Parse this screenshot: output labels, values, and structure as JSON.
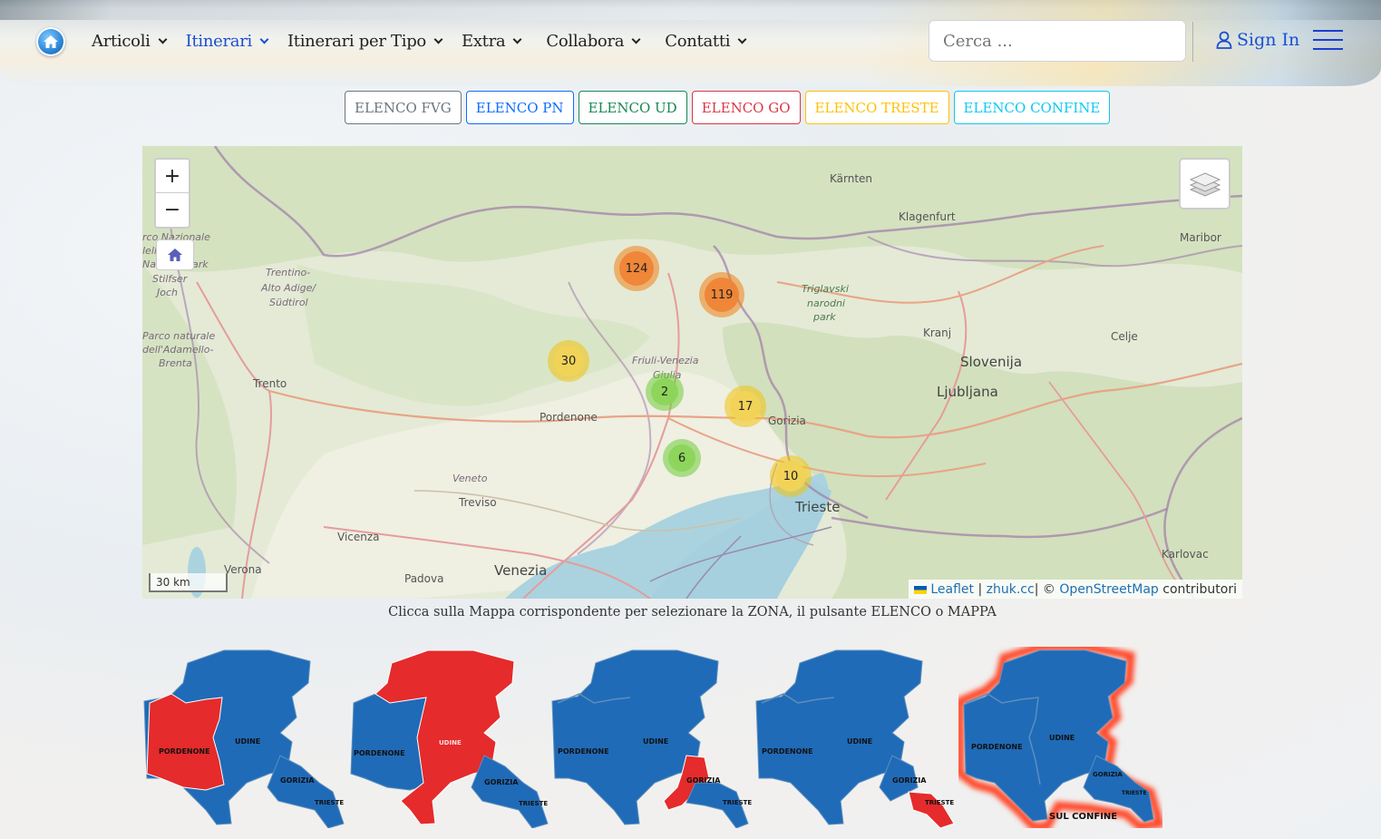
{
  "header": {
    "nav": [
      {
        "label": "Articoli"
      },
      {
        "label": "Itinerari"
      },
      {
        "label": "Itinerari per Tipo"
      },
      {
        "label": "Extra"
      },
      {
        "label": "Collabora"
      },
      {
        "label": "Contatti"
      }
    ],
    "search_placeholder": "Cerca ...",
    "signin_label": "Sign In"
  },
  "elenco_buttons": [
    {
      "label": "ELENCO FVG",
      "color": "#6c757d"
    },
    {
      "label": "ELENCO PN",
      "color": "#0d6efd"
    },
    {
      "label": "ELENCO UD",
      "color": "#198754"
    },
    {
      "label": "ELENCO GO",
      "color": "#dc3545"
    },
    {
      "label": "ELENCO TRESTE",
      "color": "#ffc107"
    },
    {
      "label": "ELENCO CONFINE",
      "color": "#0dcaf0"
    }
  ],
  "map": {
    "zoom_in": "+",
    "zoom_out": "−",
    "clusters": [
      "124",
      "119",
      "30",
      "2",
      "17",
      "6",
      "10"
    ],
    "places": {
      "karnten": "Kärnten",
      "klagenfurt": "Klagenfurt",
      "maribor": "Maribor",
      "parco_nazionale": "rco Nazionale",
      "stelvio_1": "lelle",
      "stelvio_2": "Nati",
      "stelvio_3": "ark",
      "stilfser_1": "Stilfser",
      "stilfser_2": "Joch",
      "trentino_1": "Trentino-",
      "trentino_2": "Alto Adige/",
      "trentino_3": "Südtirol",
      "triglav_1": "Triglavski",
      "triglav_2": "narodni",
      "triglav_3": "park",
      "kranj": "Kranj",
      "celje": "Celje",
      "slovenija": "Slovenija",
      "ljubljana": "Ljubljana",
      "adamello_1": "Parco naturale",
      "adamello_2": "dell'Adamello-",
      "adamello_3": "Brenta",
      "friuli_1": "Friuli-Venezia",
      "friuli_2": "Giulia",
      "trento": "Trento",
      "pordenone": "Pordenone",
      "gorizia": "Gorizia",
      "veneto": "Veneto",
      "treviso": "Treviso",
      "trieste": "Trieste",
      "vicenza": "Vicenza",
      "verona": "Verona",
      "padova": "Padova",
      "venezia": "Venezia",
      "karlovac": "Karlovac"
    },
    "scale": "30 km",
    "attribution": {
      "leaflet": "Leaflet",
      "sep1": " | ",
      "zhuk": "zhuk.cc",
      "sep2": "| © ",
      "osm": "OpenStreetMap",
      "contrib": " contributori"
    }
  },
  "caption": "Clicca sulla Mappa corrispondente per selezionare la ZONA, il pulsante ELENCO o MAPPA",
  "regions": {
    "pordenone": "PORDENONE",
    "udine": "UDINE",
    "gorizia": "GORIZIA",
    "trieste": "TRIESTE",
    "sul_confine": "SUL CONFINE",
    "colors": {
      "base": "#1f6bb8",
      "selected": "#e52b2b",
      "glow": "#ff4a2a"
    }
  }
}
